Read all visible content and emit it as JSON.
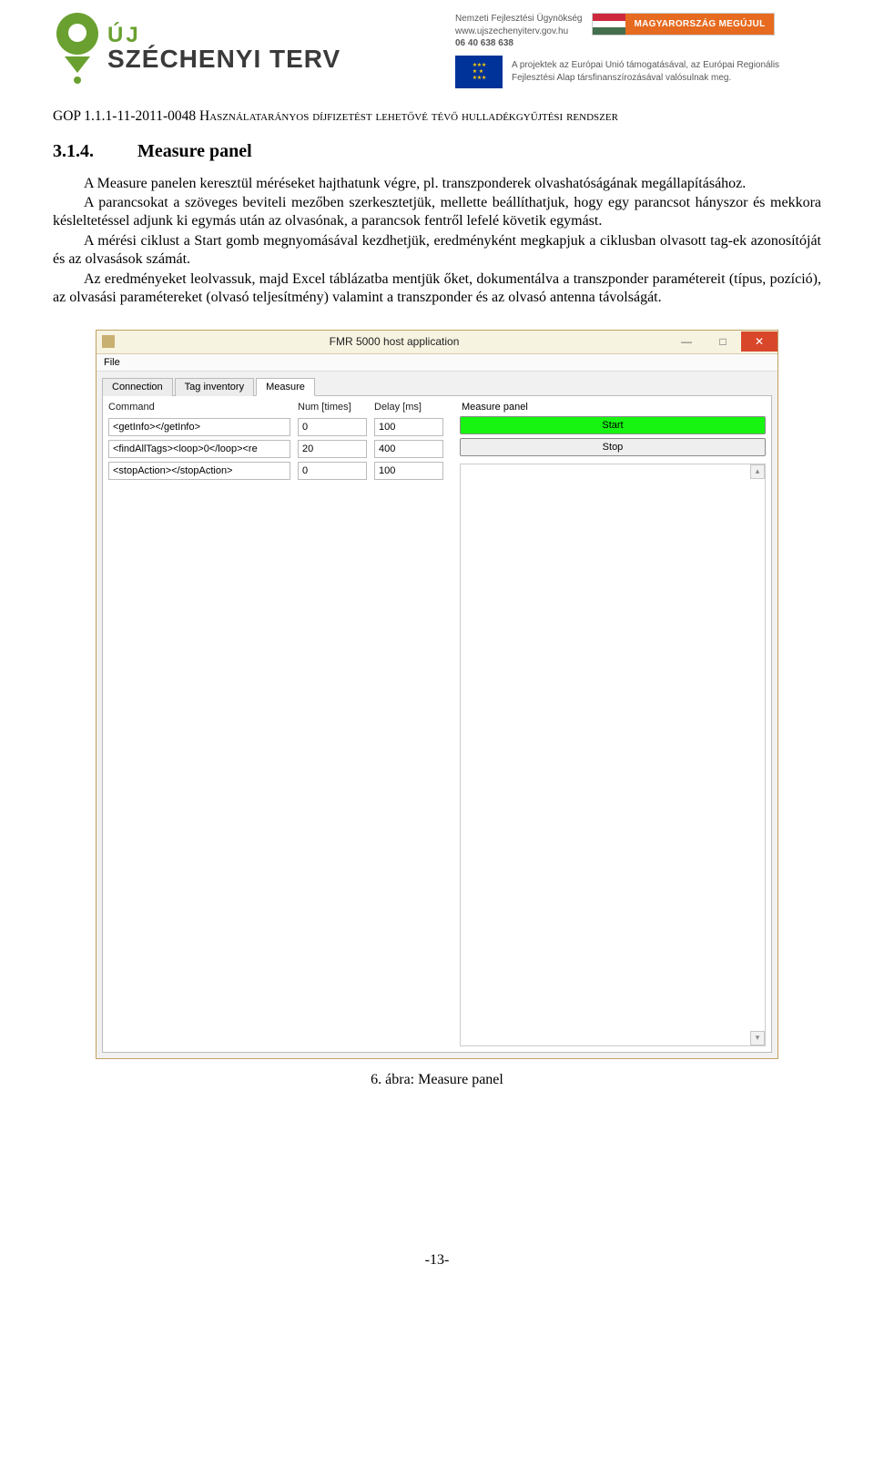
{
  "header": {
    "logo": {
      "uj": "ÚJ",
      "name": "SZÉCHENYI TERV"
    },
    "agency": {
      "line1": "Nemzeti Fejlesztési Ügynökség",
      "line2": "www.ujszechenyiterv.gov.hu",
      "line3": "06 40 638 638"
    },
    "badge": "MAGYARORSZÁG MEGÚJUL",
    "eu_text": "A projektek az Európai Unió támogatásával, az Európai Regionális Fejlesztési Alap társfinanszírozásával valósulnak meg."
  },
  "gop_line_prefix": "GOP 1.1.1-11-2011-0048 ",
  "gop_line_rest": "Használatarányos díjfizetést lehetővé tévő hulladékgyűjtési rendszer",
  "section": {
    "num": "3.1.4.",
    "title": "Measure panel"
  },
  "paragraphs": [
    "A Measure panelen keresztül méréseket hajthatunk végre, pl. transzponderek olvashatóságának megállapításához.",
    "A parancsokat a szöveges beviteli mezőben szerkesztetjük, mellette beállíthatjuk, hogy egy parancsot hányszor és mekkora késleltetéssel adjunk ki egymás után az olvasónak, a parancsok fentről lefelé követik egymást.",
    "A mérési ciklust a Start gomb megnyomásával kezdhetjük, eredményként megkapjuk a ciklusban olvasott tag-ek azonosítóját és az olvasások számát.",
    "Az eredményeket leolvassuk, majd Excel táblázatba mentjük őket, dokumentálva a transzponder paramétereit (típus, pozíció), az olvasási paramétereket (olvasó teljesítmény) valamint a transzponder és az olvasó antenna távolságát."
  ],
  "app": {
    "title": "FMR 5000 host application",
    "menu": {
      "file": "File"
    },
    "tabs": [
      "Connection",
      "Tag inventory",
      "Measure"
    ],
    "active_tab": 2,
    "headers": {
      "command": "Command",
      "num": "Num [times]",
      "delay": "Delay [ms]",
      "panel": "Measure panel"
    },
    "rows": [
      {
        "cmd": "<getInfo></getInfo>",
        "num": "0",
        "delay": "100"
      },
      {
        "cmd": "<findAllTags><loop>0</loop><re",
        "num": "20",
        "delay": "400"
      },
      {
        "cmd": "<stopAction></stopAction>",
        "num": "0",
        "delay": "100"
      }
    ],
    "buttons": {
      "start": "Start",
      "stop": "Stop"
    }
  },
  "caption": "6. ábra: Measure panel",
  "page_num": "-13-"
}
